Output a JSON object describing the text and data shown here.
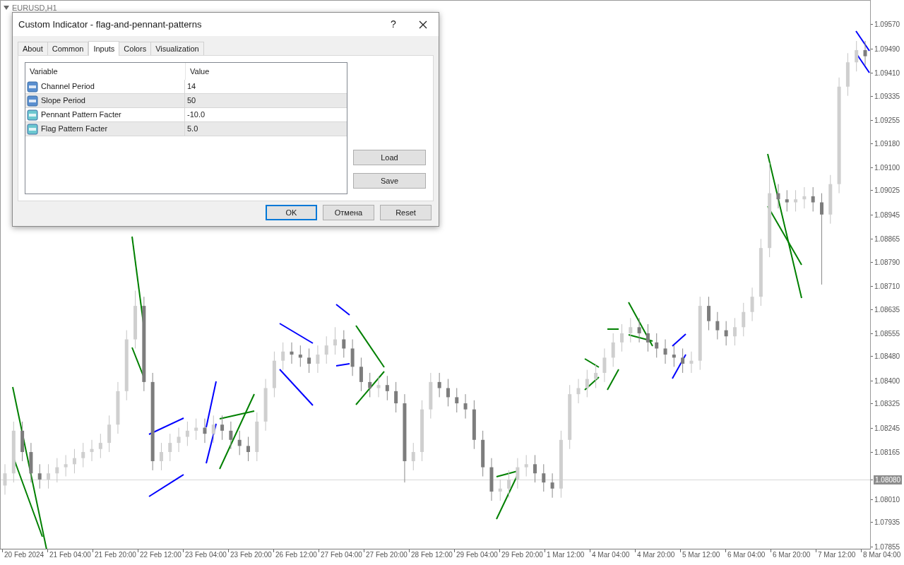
{
  "chart": {
    "symbol": "EURUSD,H1",
    "current_price": "1.08080",
    "chart_data": {
      "type": "candlestick",
      "ylim": [
        1.0785,
        1.0965
      ],
      "yticks": [
        {
          "value": 1.0957,
          "label": "1.09570"
        },
        {
          "value": 1.0949,
          "label": "1.09490"
        },
        {
          "value": 1.0941,
          "label": "1.09410"
        },
        {
          "value": 1.09335,
          "label": "1.09335"
        },
        {
          "value": 1.09255,
          "label": "1.09255"
        },
        {
          "value": 1.0918,
          "label": "1.09180"
        },
        {
          "value": 1.091,
          "label": "1.09100"
        },
        {
          "value": 1.09025,
          "label": "1.09025"
        },
        {
          "value": 1.08945,
          "label": "1.08945"
        },
        {
          "value": 1.08865,
          "label": "1.08865"
        },
        {
          "value": 1.0879,
          "label": "1.08790"
        },
        {
          "value": 1.0871,
          "label": "1.08710"
        },
        {
          "value": 1.08635,
          "label": "1.08635"
        },
        {
          "value": 1.08555,
          "label": "1.08555"
        },
        {
          "value": 1.0848,
          "label": "1.08480"
        },
        {
          "value": 1.084,
          "label": "1.08400"
        },
        {
          "value": 1.08325,
          "label": "1.08325"
        },
        {
          "value": 1.08245,
          "label": "1.08245"
        },
        {
          "value": 1.08165,
          "label": "1.08165"
        },
        {
          "value": 1.0801,
          "label": "1.08010"
        },
        {
          "value": 1.07935,
          "label": "1.07935"
        },
        {
          "value": 1.07855,
          "label": "1.07855"
        }
      ],
      "categories": [
        null,
        null,
        null,
        null,
        null,
        null,
        null,
        null,
        null,
        null,
        null,
        null,
        null,
        null,
        null,
        null,
        null,
        null,
        null,
        null,
        null,
        null,
        null,
        null,
        null,
        null,
        null,
        null,
        null,
        null,
        null,
        null,
        null,
        null,
        null,
        null,
        null,
        null,
        null,
        null,
        null,
        null,
        null,
        null,
        null,
        null,
        null,
        null,
        null,
        null,
        null,
        null,
        null,
        null,
        null,
        null,
        null,
        null,
        null,
        null,
        null,
        null,
        null,
        null,
        null,
        null,
        null,
        null,
        null,
        null,
        null,
        null,
        null,
        null,
        null,
        null,
        null,
        null,
        null,
        null,
        null,
        null,
        null,
        null,
        null,
        null,
        null,
        null,
        null,
        null,
        null,
        null,
        null,
        null,
        null,
        null,
        null,
        null,
        null,
        null
      ],
      "ohlc": [
        [
          1.0806,
          1.0813,
          1.0803,
          1.081
        ],
        [
          1.081,
          1.0827,
          1.0807,
          1.0824
        ],
        [
          1.0824,
          1.0827,
          1.0814,
          1.0817
        ],
        [
          1.0817,
          1.082,
          1.0807,
          1.081
        ],
        [
          1.081,
          1.0813,
          1.0805,
          1.0808
        ],
        [
          1.0808,
          1.0813,
          1.0805,
          1.081
        ],
        [
          1.081,
          1.0815,
          1.0807,
          1.0812
        ],
        [
          1.0812,
          1.0816,
          1.0809,
          1.0813
        ],
        [
          1.0813,
          1.0818,
          1.081,
          1.0815
        ],
        [
          1.0815,
          1.082,
          1.0812,
          1.0817
        ],
        [
          1.0817,
          1.0821,
          1.0814,
          1.0818
        ],
        [
          1.0818,
          1.0823,
          1.0815,
          1.082
        ],
        [
          1.082,
          1.0829,
          1.0817,
          1.0826
        ],
        [
          1.0826,
          1.084,
          1.0823,
          1.0837
        ],
        [
          1.0837,
          1.0857,
          1.0834,
          1.0854
        ],
        [
          1.0854,
          1.087,
          1.0851,
          1.0865
        ],
        [
          1.0865,
          1.0868,
          1.0837,
          1.084
        ],
        [
          1.084,
          1.0843,
          1.0811,
          1.0814
        ],
        [
          1.0814,
          1.082,
          1.0811,
          1.0817
        ],
        [
          1.0817,
          1.0823,
          1.0814,
          1.082
        ],
        [
          1.082,
          1.0825,
          1.0817,
          1.0822
        ],
        [
          1.0822,
          1.0827,
          1.0819,
          1.0824
        ],
        [
          1.0824,
          1.0828,
          1.0821,
          1.0825
        ],
        [
          1.0825,
          1.0828,
          1.082,
          1.0823
        ],
        [
          1.0823,
          1.0829,
          1.082,
          1.0826
        ],
        [
          1.0826,
          1.0829,
          1.0821,
          1.0824
        ],
        [
          1.0824,
          1.0827,
          1.0818,
          1.0821
        ],
        [
          1.0821,
          1.0824,
          1.0816,
          1.0819
        ],
        [
          1.0819,
          1.0822,
          1.0814,
          1.0817
        ],
        [
          1.0817,
          1.083,
          1.0814,
          1.0827
        ],
        [
          1.0827,
          1.0841,
          1.0824,
          1.0838
        ],
        [
          1.0838,
          1.085,
          1.0835,
          1.0847
        ],
        [
          1.0847,
          1.0853,
          1.0844,
          1.085
        ],
        [
          1.085,
          1.0853,
          1.0846,
          1.0849
        ],
        [
          1.0849,
          1.0852,
          1.0845,
          1.0848
        ],
        [
          1.0848,
          1.0851,
          1.0843,
          1.0846
        ],
        [
          1.0846,
          1.0852,
          1.0843,
          1.0849
        ],
        [
          1.0849,
          1.0855,
          1.0846,
          1.0852
        ],
        [
          1.0852,
          1.0858,
          1.0849,
          1.0854
        ],
        [
          1.0854,
          1.0857,
          1.0848,
          1.0851
        ],
        [
          1.0851,
          1.0854,
          1.0842,
          1.0845
        ],
        [
          1.0845,
          1.0848,
          1.0837,
          1.084
        ],
        [
          1.084,
          1.0843,
          1.0835,
          1.0838
        ],
        [
          1.0838,
          1.0842,
          1.0835,
          1.0839
        ],
        [
          1.0839,
          1.0842,
          1.0834,
          1.0837
        ],
        [
          1.0837,
          1.084,
          1.083,
          1.0833
        ],
        [
          1.0833,
          1.0836,
          1.0807,
          1.0814
        ],
        [
          1.0814,
          1.082,
          1.0811,
          1.0817
        ],
        [
          1.0817,
          1.0834,
          1.0814,
          1.0831
        ],
        [
          1.0831,
          1.0843,
          1.0828,
          1.084
        ],
        [
          1.084,
          1.0843,
          1.0835,
          1.0838
        ],
        [
          1.0838,
          1.0841,
          1.0832,
          1.0835
        ],
        [
          1.0835,
          1.0838,
          1.083,
          1.0833
        ],
        [
          1.0833,
          1.0836,
          1.0828,
          1.0831
        ],
        [
          1.0831,
          1.0834,
          1.0818,
          1.0821
        ],
        [
          1.0821,
          1.0824,
          1.0809,
          1.0812
        ],
        [
          1.0812,
          1.0815,
          1.0801,
          1.0804
        ],
        [
          1.0804,
          1.0808,
          1.0801,
          1.0805
        ],
        [
          1.0805,
          1.0811,
          1.0802,
          1.0808
        ],
        [
          1.0808,
          1.0815,
          1.0805,
          1.0812
        ],
        [
          1.0812,
          1.0816,
          1.0809,
          1.0813
        ],
        [
          1.0813,
          1.0816,
          1.0807,
          1.081
        ],
        [
          1.081,
          1.0813,
          1.0804,
          1.0807
        ],
        [
          1.0807,
          1.081,
          1.0802,
          1.0805
        ],
        [
          1.0805,
          1.0824,
          1.0802,
          1.0821
        ],
        [
          1.0821,
          1.0839,
          1.0818,
          1.0836
        ],
        [
          1.0836,
          1.0841,
          1.0833,
          1.0838
        ],
        [
          1.0838,
          1.0844,
          1.0835,
          1.0841
        ],
        [
          1.0841,
          1.0846,
          1.0838,
          1.0843
        ],
        [
          1.0843,
          1.0851,
          1.084,
          1.0848
        ],
        [
          1.0848,
          1.0856,
          1.0845,
          1.0853
        ],
        [
          1.0853,
          1.0859,
          1.085,
          1.0856
        ],
        [
          1.0856,
          1.0861,
          1.0853,
          1.0858
        ],
        [
          1.0858,
          1.0861,
          1.0853,
          1.0856
        ],
        [
          1.0856,
          1.0859,
          1.085,
          1.0853
        ],
        [
          1.0853,
          1.0856,
          1.0848,
          1.0851
        ],
        [
          1.0851,
          1.0854,
          1.0846,
          1.0849
        ],
        [
          1.0849,
          1.0852,
          1.0845,
          1.0848
        ],
        [
          1.0848,
          1.0851,
          1.0843,
          1.0846
        ],
        [
          1.0846,
          1.085,
          1.0843,
          1.0847
        ],
        [
          1.0847,
          1.0868,
          1.0844,
          1.0865
        ],
        [
          1.0865,
          1.0868,
          1.0857,
          1.086
        ],
        [
          1.086,
          1.0863,
          1.0854,
          1.0857
        ],
        [
          1.0857,
          1.086,
          1.0852,
          1.0855
        ],
        [
          1.0855,
          1.0861,
          1.0852,
          1.0858
        ],
        [
          1.0858,
          1.0866,
          1.0855,
          1.0863
        ],
        [
          1.0863,
          1.0871,
          1.086,
          1.0868
        ],
        [
          1.0868,
          1.0887,
          1.0865,
          1.0884
        ],
        [
          1.0884,
          1.0912,
          1.0881,
          1.0902
        ],
        [
          1.0902,
          1.0905,
          1.0897,
          1.09
        ],
        [
          1.09,
          1.0903,
          1.0896,
          1.0899
        ],
        [
          1.0899,
          1.0903,
          1.0896,
          1.09
        ],
        [
          1.09,
          1.0904,
          1.0897,
          1.0901
        ],
        [
          1.0901,
          1.0904,
          1.0896,
          1.0899
        ],
        [
          1.0899,
          1.0902,
          1.0872,
          1.0895
        ],
        [
          1.0895,
          1.0908,
          1.0892,
          1.0905
        ],
        [
          1.0905,
          1.094,
          1.0902,
          1.0937
        ],
        [
          1.0937,
          1.0948,
          1.0934,
          1.0945
        ],
        [
          1.0945,
          1.0952,
          1.0942,
          1.0949
        ],
        [
          1.0949,
          1.0952,
          1.0944,
          1.0947
        ]
      ]
    },
    "time_labels": [
      "20 Feb 2024",
      "21 Feb 04:00",
      "21 Feb 20:00",
      "22 Feb 12:00",
      "23 Feb 04:00",
      "23 Feb 20:00",
      "26 Feb 12:00",
      "27 Feb 04:00",
      "27 Feb 20:00",
      "28 Feb 12:00",
      "29 Feb 04:00",
      "29 Feb 20:00",
      "1 Mar 12:00",
      "4 Mar 04:00",
      "4 Mar 20:00",
      "5 Mar 12:00",
      "6 Mar 04:00",
      "6 Mar 20:00",
      "7 Mar 12:00",
      "8 Mar 04:00"
    ]
  },
  "dialog": {
    "title": "Custom Indicator - flag-and-pennant-patterns",
    "help": "?",
    "tabs": [
      {
        "label": "About",
        "selected": false
      },
      {
        "label": "Common",
        "selected": false
      },
      {
        "label": "Inputs",
        "selected": true
      },
      {
        "label": "Colors",
        "selected": false
      },
      {
        "label": "Visualization",
        "selected": false
      }
    ],
    "table": {
      "columns": [
        "Variable",
        "Value"
      ],
      "rows": [
        {
          "kind": "integer",
          "variable": "Channel Period",
          "value": "14"
        },
        {
          "kind": "integer",
          "variable": "Slope Period",
          "value": "50"
        },
        {
          "kind": "double",
          "variable": "Pennant Pattern Facter",
          "value": "-10.0"
        },
        {
          "kind": "double",
          "variable": "Flag Pattern Facter",
          "value": "5.0"
        }
      ]
    },
    "side_buttons": [
      "Load",
      "Save"
    ],
    "buttons": [
      {
        "label": "OK",
        "default": true
      },
      {
        "label": "Отмена",
        "default": false
      },
      {
        "label": "Reset",
        "default": false
      }
    ]
  }
}
